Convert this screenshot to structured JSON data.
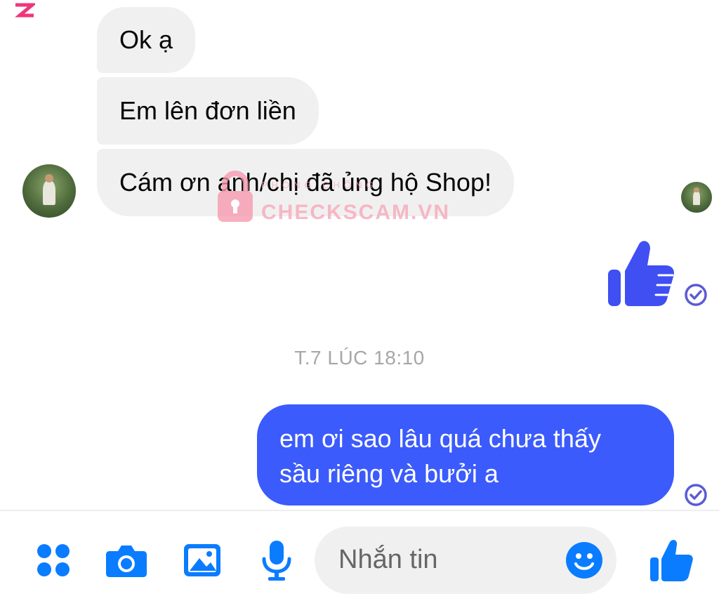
{
  "conversation": {
    "incoming_messages": [
      {
        "text": "Ok ạ"
      },
      {
        "text": "Em lên đơn liền"
      },
      {
        "text": "Cám ơn anh/chị đã ủng hộ Shop!"
      }
    ],
    "timestamp": "T.7 LÚC 18:10",
    "outgoing_message": {
      "lines": [
        "em ơi sao lâu quá chưa thấy",
        "sầu riêng và bưởi a"
      ]
    }
  },
  "watermark": {
    "small_text": "PHÒNG CHỐNG",
    "brand_text": "CHECKSCAM.VN"
  },
  "composer": {
    "placeholder": "Nhắn tin",
    "tools": [
      "apps-icon",
      "camera-icon",
      "image-icon",
      "microphone-icon"
    ]
  },
  "colors": {
    "accent": "#3b5bfc",
    "incoming_bubble": "#f1f0f0",
    "like_blue": "#3f4ff2",
    "icon_blue": "#0a7cff",
    "watermark_pink": "#f6aaba"
  }
}
